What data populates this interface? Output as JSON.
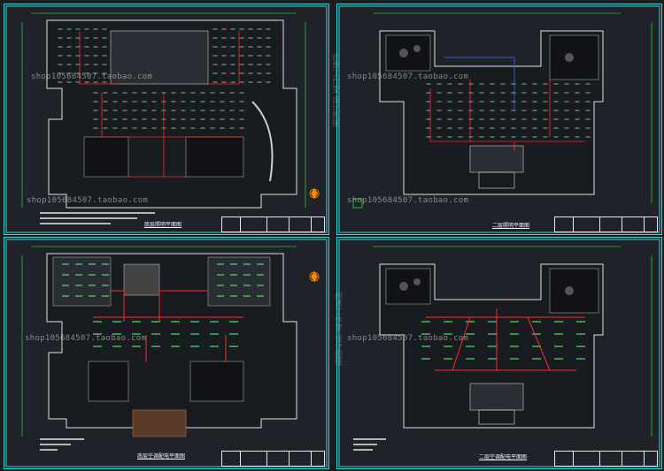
{
  "sheets": [
    {
      "id": "tl",
      "caption": "底层照明平面图"
    },
    {
      "id": "tr",
      "caption": "二层照明平面图"
    },
    {
      "id": "bl",
      "caption": "底层空调配电平面图"
    },
    {
      "id": "br",
      "caption": "二层空调配电平面图"
    }
  ],
  "watermark": {
    "text": "shop105684507.taobao.com",
    "vertical": "创意工作室 设计图纸"
  },
  "colors": {
    "frame": "#33d6d6",
    "wall": "#e0e0e0",
    "light": "#22ff33",
    "circuit": "#ff2a2a",
    "fixture": "#ff44ff",
    "blue": "#3a6bff",
    "compass": "#ff8800"
  }
}
